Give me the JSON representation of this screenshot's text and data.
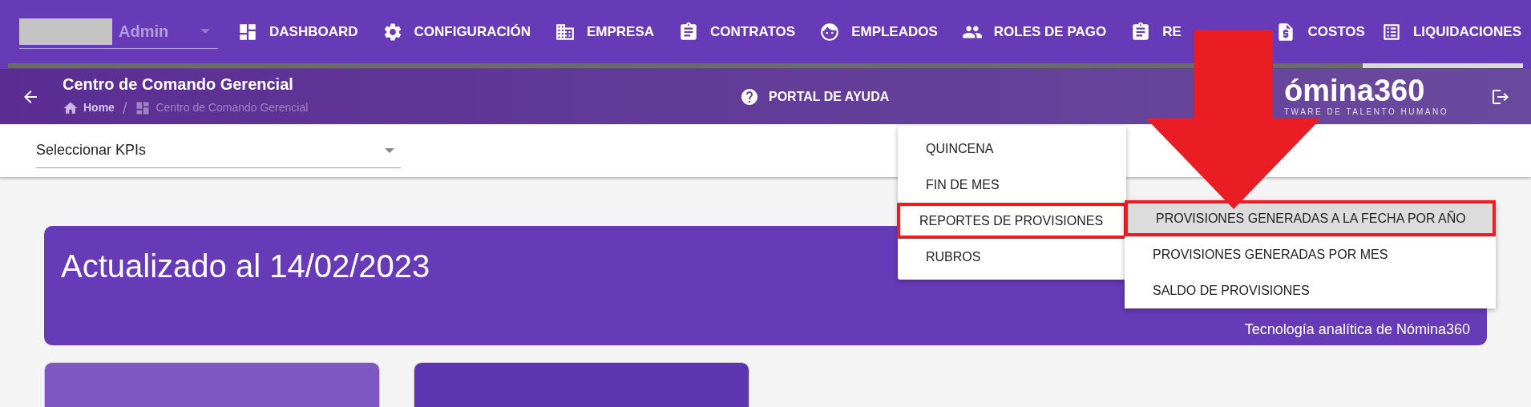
{
  "nav": {
    "user_select": {
      "value": "Admin"
    },
    "items": [
      {
        "label": "DASHBOARD",
        "kind": "dashboard"
      },
      {
        "label": "CONFIGURACIÓN",
        "kind": "settings"
      },
      {
        "label": "EMPRESA",
        "kind": "building"
      },
      {
        "label": "CONTRATOS",
        "kind": "clipboard"
      },
      {
        "label": "EMPLEADOS",
        "kind": "face"
      },
      {
        "label": "ROLES DE PAGO",
        "kind": "people"
      },
      {
        "label": "RE",
        "kind": "clipboard"
      },
      {
        "label": "COSTOS",
        "kind": "invoice"
      },
      {
        "label": "LIQUIDACIONES",
        "kind": "list"
      }
    ]
  },
  "header": {
    "title": "Centro de Comando Gerencial",
    "breadcrumb_separator": "/",
    "breadcrumb": [
      {
        "label": "Home",
        "kind": "home"
      },
      {
        "label": "Centro de Comando Gerencial",
        "kind": "dashboard"
      }
    ],
    "help_link": "PORTAL DE AYUDA",
    "logo": {
      "name": "ómina360",
      "tagline": "TWARE DE TALENTO HUMANO"
    }
  },
  "kpi_select": {
    "placeholder": "Seleccionar KPIs"
  },
  "banner": {
    "title": "Actualizado al 14/02/2023",
    "footer": "Tecnología analítica de Nómina360"
  },
  "menu": {
    "items": [
      {
        "label": "QUINCENA",
        "highlighted": false
      },
      {
        "label": "FIN DE MES",
        "highlighted": false
      },
      {
        "label": "REPORTES DE PROVISIONES",
        "highlighted": true
      },
      {
        "label": "RUBROS",
        "highlighted": false
      }
    ]
  },
  "submenu": {
    "items": [
      {
        "label": "PROVISIONES GENERADAS A LA FECHA POR AÑO",
        "selected": true,
        "highlighted": true
      },
      {
        "label": "PROVISIONES GENERADAS POR MES",
        "selected": false,
        "highlighted": false
      },
      {
        "label": "SALDO DE PROVISIONES",
        "selected": false,
        "highlighted": false
      }
    ]
  },
  "cards": [
    {
      "color": "#7e57c2"
    },
    {
      "color": "#5e35b1"
    }
  ]
}
